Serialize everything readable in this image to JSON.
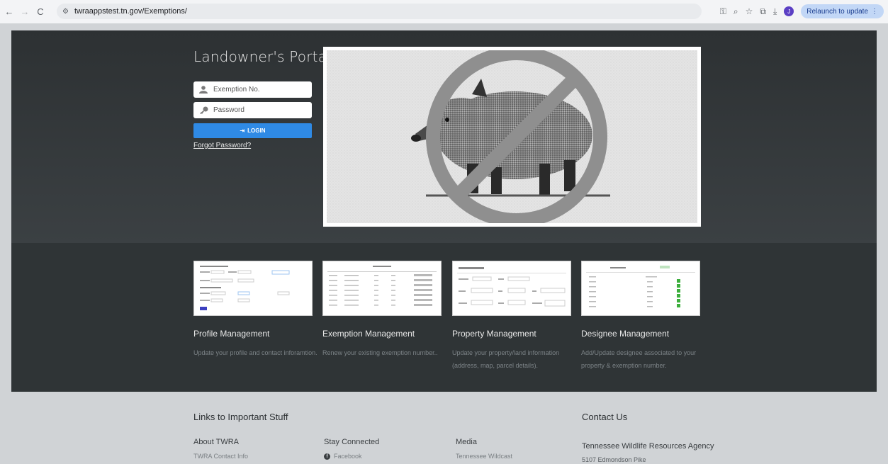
{
  "browser": {
    "back": "←",
    "forward": "→",
    "reload": "C",
    "url": "twraappstest.tn.gov/Exemptions/",
    "relaunch_label": "Relaunch to update",
    "avatar_initial": "J"
  },
  "login": {
    "title": "Landowner's Portal..",
    "exemption_placeholder": "Exemption No.",
    "password_placeholder": "Password",
    "login_label": "LOGIN",
    "forgot_label": "Forgot Password?"
  },
  "features": [
    {
      "title": "Profile Management",
      "desc": "Update your profile and contact inforamtion."
    },
    {
      "title": "Exemption Management",
      "desc": "Renew your existing exemption number.."
    },
    {
      "title": "Property Management",
      "desc": "Update your property/land information (address, map, parcel details)."
    },
    {
      "title": "Designee Management",
      "desc": "Add/Update designee associated to your property & exemption number."
    }
  ],
  "footer": {
    "links_title": "Links to Important Stuff",
    "contact_title": "Contact Us",
    "about_head": "About TWRA",
    "about_link": "TWRA Contact Info",
    "connected_head": "Stay Connected",
    "connected_link": "Facebook",
    "media_head": "Media",
    "media_link": "Tennessee Wildcast",
    "agency": "Tennessee Wildlife Resources Agency",
    "address": "5107 Edmondson Pike"
  }
}
